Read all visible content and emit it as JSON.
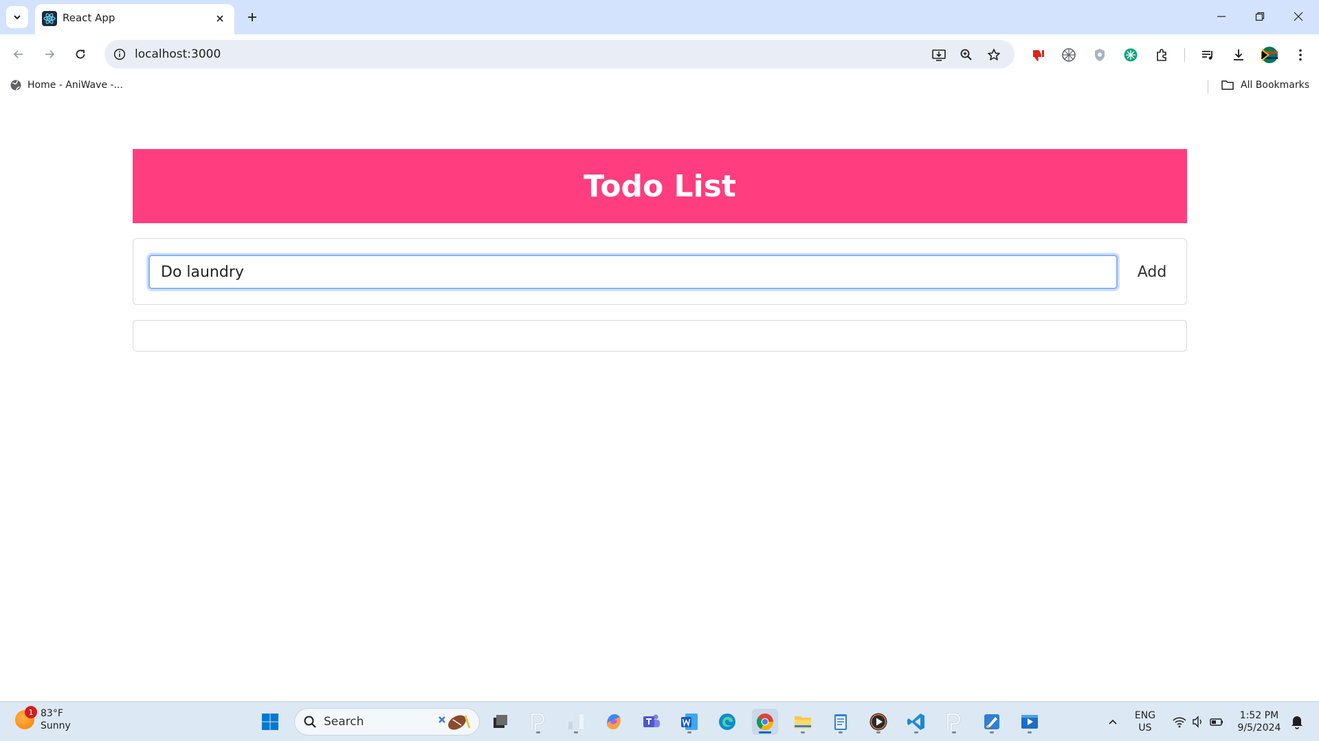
{
  "browser": {
    "tab_title": "React App",
    "url": "localhost:3000",
    "bookmark_home": "Home - AniWave -...",
    "all_bookmarks": "All Bookmarks"
  },
  "app": {
    "title": "Todo List",
    "input_value": "Do laundry",
    "add_label": "Add",
    "todos": []
  },
  "taskbar": {
    "weather_temp": "83°F",
    "weather_desc": "Sunny",
    "weather_badge": "1",
    "search_label": "Search",
    "lang_line1": "ENG",
    "lang_line2": "US",
    "time": "1:52 PM",
    "date": "9/5/2024"
  },
  "colors": {
    "header": "#ff3d7f",
    "tabstrip": "#d3e3fd",
    "taskbar": "#dce8f4"
  }
}
